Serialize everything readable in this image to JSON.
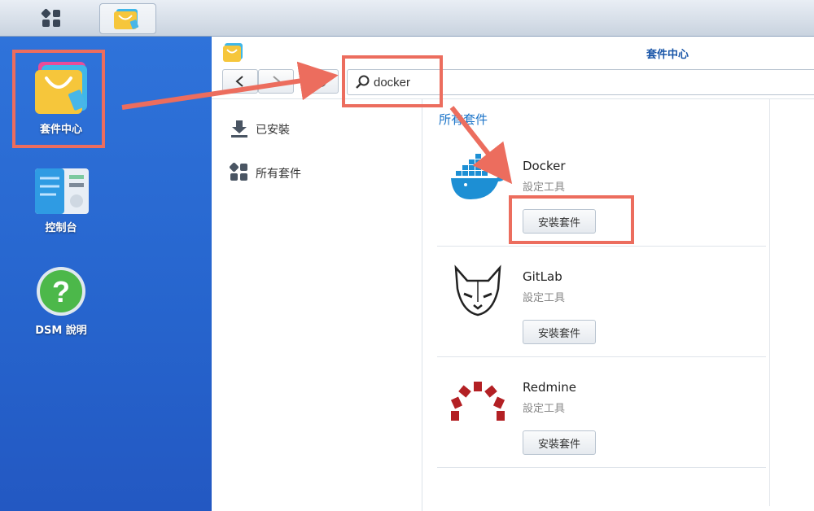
{
  "taskbar": {
    "main_menu_icon": "grid-icon",
    "package_tab_icon": "package-center-icon"
  },
  "desktop": {
    "icons": [
      {
        "label": "套件中心",
        "icon": "package-center-icon"
      },
      {
        "label": "控制台",
        "icon": "control-panel-icon"
      },
      {
        "label": "DSM 說明",
        "icon": "help-icon"
      }
    ]
  },
  "window": {
    "title": "套件中心",
    "search": {
      "value": "docker"
    },
    "sidebar": [
      {
        "label": "已安裝",
        "icon": "download-icon"
      },
      {
        "label": "所有套件",
        "icon": "grid-icon"
      }
    ],
    "section_title": "所有套件",
    "packages": [
      {
        "name": "Docker",
        "category": "設定工具",
        "button": "安裝套件",
        "icon": "docker-whale-icon"
      },
      {
        "name": "GitLab",
        "category": "設定工具",
        "button": "安裝套件",
        "icon": "gitlab-fox-icon"
      },
      {
        "name": "Redmine",
        "category": "設定工具",
        "button": "安裝套件",
        "icon": "redmine-arc-icon"
      }
    ]
  },
  "annotation_color": "#ec6d5e"
}
